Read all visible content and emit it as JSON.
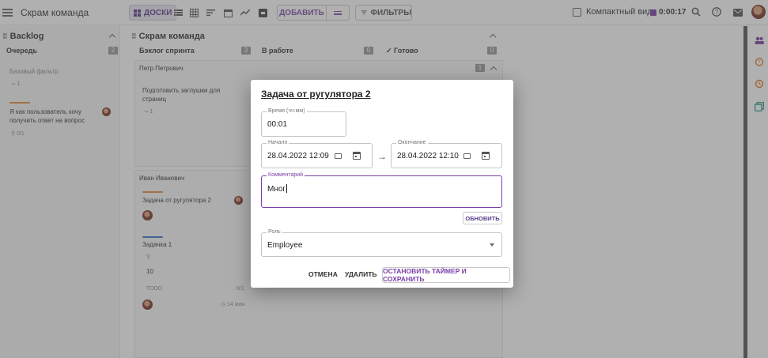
{
  "topbar": {
    "app_title": "Скрам команда",
    "view_label": "ДОСКИ",
    "add_label": "ДОБАВИТЬ",
    "filters_label": "ФИЛЬТРЫ",
    "compact_label": "Компактный вид",
    "timer": "0:00:17"
  },
  "backlog": {
    "title": "Backlog",
    "queue_label": "Очередь",
    "queue_count": "2",
    "base_filter": "Базовый фильтр",
    "card_text_1": "Я как пользователь хочу",
    "card_text_2": "получить ответ на вопрос",
    "card_meta": "0/1"
  },
  "board": {
    "title": "Скрам команда",
    "columns": [
      {
        "label": "Бэклог спринта",
        "count": "3"
      },
      {
        "label": "В работе",
        "count": "0"
      },
      {
        "label": "Готово",
        "count": "0"
      }
    ],
    "lane1": {
      "person": "Петр Петрович",
      "count": "1",
      "card_text_1": "Подготовить заглушки для",
      "card_text_2": "страниц"
    },
    "lane2": {
      "person": "Иван Иванович",
      "card1": "Задача от рyгулятора 2",
      "card2": "Задачка 1",
      "card2_num": "10",
      "card2_status": "TODO",
      "card2_ratio": "0/1",
      "card2_date": "14 мая"
    }
  },
  "dialog": {
    "title": "Задача от рyгулятора 2",
    "time_label": "Время (чч:мм)",
    "time_value": "00:01",
    "start_label": "Начало",
    "start_value": "28.04.2022 12:09",
    "end_label": "Окончание",
    "end_value": "28.04.2022 12:10",
    "arrow": "→",
    "comment_label": "Комментарий",
    "comment_value": "Мног",
    "update_label": "ОБНОВИТЬ",
    "role_label": "Роль",
    "role_value": "Employee",
    "cancel_label": "ОТМЕНА",
    "delete_label": "УДАЛИТЬ",
    "save_label": "ОСТАНОВИТЬ ТАЙМЕР И СОХРАНИТЬ"
  },
  "colors": {
    "accent": "#7b3fa8",
    "overlay": "#505050"
  }
}
